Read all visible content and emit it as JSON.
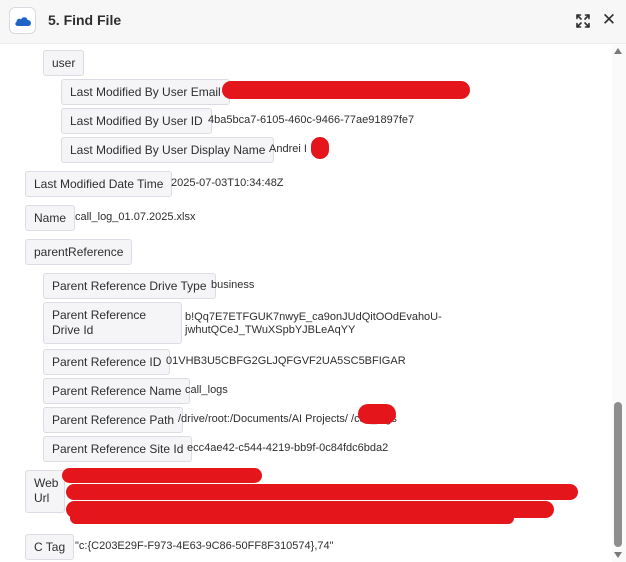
{
  "header": {
    "title": "5. Find File",
    "app_icon": "onedrive-cloud-icon",
    "expand_icon": "expand-arrows-icon",
    "close_icon": "close-icon",
    "close_glyph": "✕"
  },
  "fields": {
    "user": "user",
    "last_modified_by_user_email": {
      "key": "Last Modified By User Email",
      "value": ""
    },
    "last_modified_by_user_id": {
      "key": "Last Modified By User ID",
      "value": "4ba5bca7-6105-460c-9466-77ae91897fe7"
    },
    "last_modified_by_user_display_name": {
      "key": "Last Modified By User Display Name",
      "value": "Andrei I"
    },
    "last_modified_date_time": {
      "key": "Last Modified Date Time",
      "value": "2025-07-03T10:34:48Z"
    },
    "name": {
      "key": "Name",
      "value": "call_log_01.07.2025.xlsx"
    },
    "parent_reference": "parentReference",
    "parent_reference_drive_type": {
      "key": "Parent Reference Drive Type",
      "value": "business"
    },
    "parent_reference_drive_id": {
      "key": "Parent Reference Drive Id",
      "value": "b!Qq7E7ETFGUK7nwyE_ca9onJUdQitOOdEvahoU-jwhutQCeJ_TWuXSpbYJBLeAqYY"
    },
    "parent_reference_id": {
      "key": "Parent Reference ID",
      "value": "01VHB3U5CBFG2GLJQFGVF2UA5SC5BFIGAR"
    },
    "parent_reference_name": {
      "key": "Parent Reference Name",
      "value": "call_logs"
    },
    "parent_reference_path": {
      "key": "Parent Reference Path",
      "value": "/drive/root:/Documents/AI Projects/        /call_logs"
    },
    "parent_reference_site_id": {
      "key": "Parent Reference Site Id",
      "value": "ecc4ae42-c544-4219-bb9f-0c84fdc6bda2"
    },
    "web_url": {
      "key": "Web Url",
      "value": ""
    },
    "c_tag": {
      "key": "C Tag",
      "value": "\"c:{C203E29F-F973-4E63-9C86-50FF8F310574},74\""
    }
  },
  "colors": {
    "redaction": "#e4161c",
    "key_background": "#f5f5f8",
    "key_border": "#dcdce4",
    "header_background": "#f7f7f8",
    "scrollbar_thumb": "#8e8e8e",
    "onedrive_blue": "#1f63c6"
  }
}
